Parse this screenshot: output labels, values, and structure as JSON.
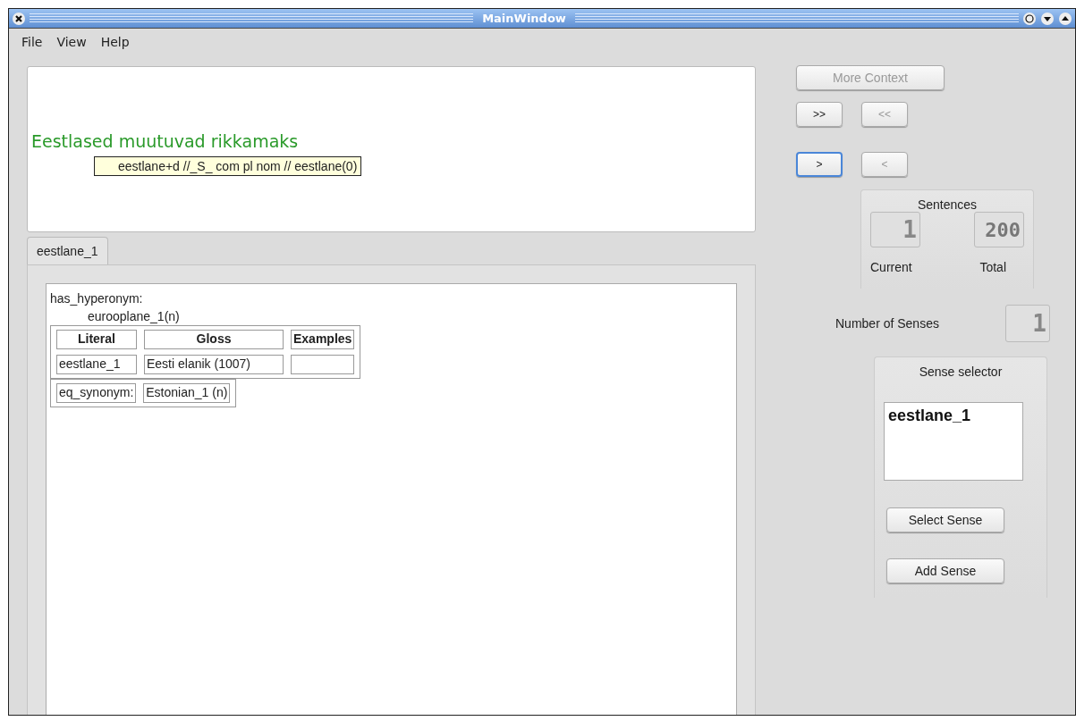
{
  "window": {
    "title": "MainWindow"
  },
  "menu": [
    "File",
    "View",
    "Help"
  ],
  "sentence": {
    "text": "Eestlased muutuvad rikkamaks",
    "tooltip": "eestlane+d //_S_ com pl nom // eestlane(0)"
  },
  "tabs": [
    {
      "label": "eestlane_1",
      "selected": true
    }
  ],
  "synset": {
    "relation": "has_hyperonym:",
    "target": "eurooplane_1(n)",
    "columns": [
      "Literal",
      "Gloss",
      "Examples"
    ],
    "row": {
      "literal": "eestlane_1",
      "gloss": "Eesti elanik (1007)"
    },
    "equivalence": {
      "label": "eq_synonym:",
      "value": "Estonian_1 (n)"
    }
  },
  "controls": {
    "more_context": {
      "label": "More Context",
      "disabled": true
    },
    "nav": [
      {
        "label": ">>",
        "disabled": false,
        "focused": false
      },
      {
        "label": "<<",
        "disabled": true,
        "focused": false
      },
      {
        "label": ">",
        "disabled": false,
        "focused": true
      },
      {
        "label": "<",
        "disabled": true,
        "focused": false
      }
    ]
  },
  "sentences": {
    "title": "Sentences",
    "current": "1",
    "total": "200",
    "current_label": "Current",
    "total_label": "Total"
  },
  "senses": {
    "label": "Number of Senses",
    "count": "1"
  },
  "sense_selector": {
    "title": "Sense selector",
    "items": [
      {
        "label": "eestlane_1",
        "selected": false
      }
    ],
    "buttons": [
      "Select Sense",
      "Add Sense"
    ]
  }
}
